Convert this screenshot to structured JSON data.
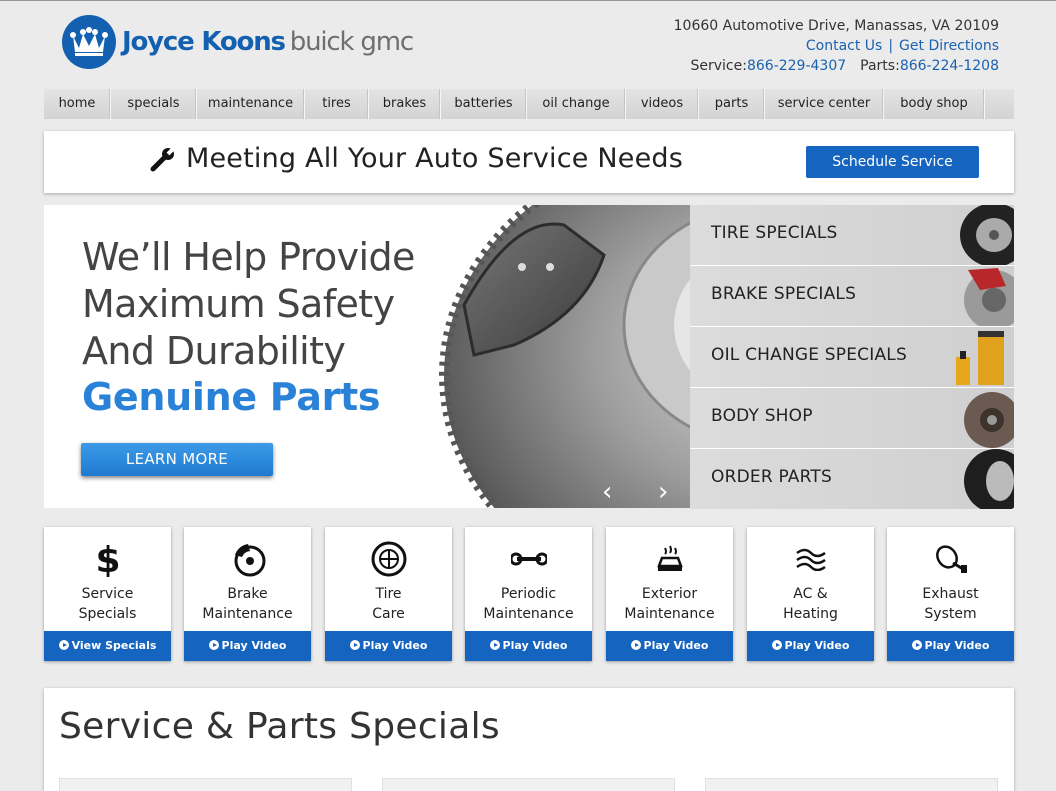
{
  "header": {
    "logo_name": "Joyce Koons",
    "logo_brand": "buick gmc",
    "address": "10660 Automotive Drive, Manassas, VA 20109",
    "contact_link": "Contact Us",
    "directions_link": "Get Directions",
    "separator": "|",
    "service_label": "Service:",
    "service_phone": "866-229-4307",
    "parts_label": "Parts:",
    "parts_phone": "866-224-1208",
    "brand_color": "#1460b0"
  },
  "nav": {
    "items": [
      {
        "label": "home"
      },
      {
        "label": "specials"
      },
      {
        "label": "maintenance"
      },
      {
        "label": "tires"
      },
      {
        "label": "brakes"
      },
      {
        "label": "batteries"
      },
      {
        "label": "oil change"
      },
      {
        "label": "videos"
      },
      {
        "label": "parts"
      },
      {
        "label": "service center"
      },
      {
        "label": "body shop"
      }
    ]
  },
  "banner": {
    "title": "Meeting All Your Auto Service Needs",
    "icon": "wrench-icon",
    "button": "Schedule Service"
  },
  "hero": {
    "line1": "We’ll Help Provide",
    "line2": "Maximum Safety",
    "line3": "And Durability",
    "highlight": "Genuine Parts",
    "button": "LEARN MORE",
    "prev": "‹",
    "next": "›",
    "accent_color": "#2a82d8"
  },
  "side_links": [
    {
      "label": "TIRE SPECIALS",
      "icon": "tire-icon"
    },
    {
      "label": "BRAKE SPECIALS",
      "icon": "brake-icon"
    },
    {
      "label": "OIL CHANGE SPECIALS",
      "icon": "oil-filter-icon"
    },
    {
      "label": "BODY SHOP",
      "icon": "gear-icon"
    },
    {
      "label": "ORDER PARTS",
      "icon": "tire-icon"
    }
  ],
  "cards": [
    {
      "label": "Service\nSpecials",
      "button": "View Specials",
      "icon": "dollar-icon"
    },
    {
      "label": "Brake\nMaintenance",
      "button": "Play Video",
      "icon": "brake-icon"
    },
    {
      "label": "Tire\nCare",
      "button": "Play Video",
      "icon": "tire-icon"
    },
    {
      "label": "Periodic\nMaintenance",
      "button": "Play Video",
      "icon": "wrench-icon"
    },
    {
      "label": "Exterior\nMaintenance",
      "button": "Play Video",
      "icon": "car-wash-icon"
    },
    {
      "label": "AC &\nHeating",
      "button": "Play Video",
      "icon": "air-flow-icon"
    },
    {
      "label": "Exhaust\nSystem",
      "button": "Play Video",
      "icon": "exhaust-icon"
    }
  ],
  "specials": {
    "title": "Service & Parts Specials"
  }
}
